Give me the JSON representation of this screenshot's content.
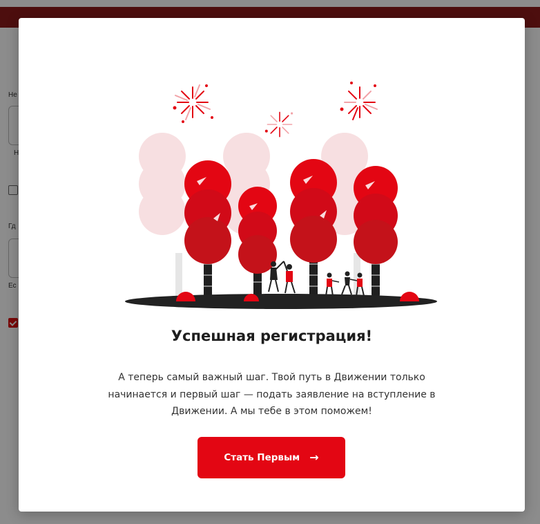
{
  "background_page": {
    "labels": [
      "Не",
      "Н",
      "Гд",
      "Ес"
    ]
  },
  "modal": {
    "illustration_icon": "celebration-trees-illustration",
    "title": "Успешная регистрация!",
    "body_lines": [
      "А теперь самый важный шаг. Твой путь в Движении только",
      "начинается и первый шаг — подать заявление на вступление в",
      "Движении. А мы тебе в этом поможем!"
    ],
    "cta": {
      "label": "Стать Первым",
      "icon": "arrow-right-icon",
      "arrow_glyph": "→"
    }
  },
  "colors": {
    "accent": "#e30613",
    "accent_dark": "#c4121a",
    "tree_pale": "#f7dfe1",
    "ground": "#222222",
    "overlay": "rgba(0,0,0,0.45)",
    "topbar": "#8c1a1a"
  }
}
